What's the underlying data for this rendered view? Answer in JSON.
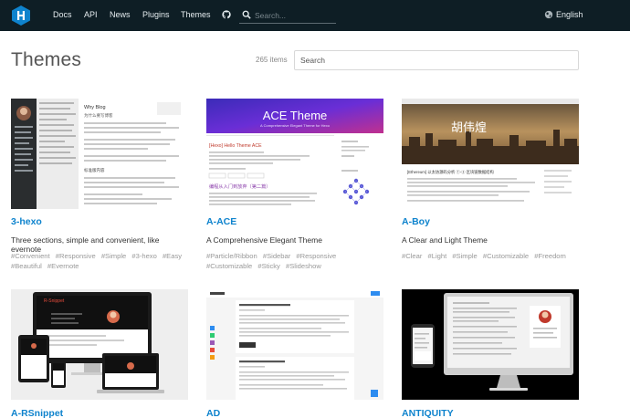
{
  "header": {
    "nav": [
      "Docs",
      "API",
      "News",
      "Plugins",
      "Themes"
    ],
    "search_placeholder": "Search...",
    "language": "English",
    "icons": [
      "hexo-logo-icon",
      "github-icon",
      "search-icon",
      "globe-icon"
    ]
  },
  "page": {
    "title": "Themes",
    "count": "265 items",
    "search_placeholder": "Search"
  },
  "themes": [
    {
      "name": "3-hexo",
      "description": "Three sections, simple and convenient, like evernote",
      "tags": [
        "#Convenient",
        "#Responsive",
        "#Simple",
        "#3-hexo",
        "#Easy",
        "#Beautiful",
        "#Evernote"
      ]
    },
    {
      "name": "A-ACE",
      "description": "A Comprehensive Elegant Theme",
      "tags": [
        "#Particle/Ribbon",
        "#Sidebar",
        "#Responsive",
        "#Customizable",
        "#Sticky",
        "#Slideshow"
      ]
    },
    {
      "name": "A-Boy",
      "description": "A Clear and Light Theme",
      "tags": [
        "#Clear",
        "#Light",
        "#Simple",
        "#Customizable",
        "#Freedom"
      ]
    },
    {
      "name": "A-RSnippet"
    },
    {
      "name": "AD"
    },
    {
      "name": "ANTIQUITY"
    }
  ],
  "previews": {
    "three_hexo": {
      "heading": "Why Blog",
      "subheading": "为什么要写博客",
      "section": "标准版内容"
    },
    "ace": {
      "title": "ACE Theme",
      "subtitle": "A Comprehensive Elegant Theme for Hexo",
      "post_title": "[Hexo] Hello Theme ACE",
      "post2_title": "编程从入门到放弃（第二篇）"
    },
    "aboy": {
      "hero_title": "胡伟煌",
      "post_title": "[Ethereum] 以太坊源码分析 ①-② 区块链数据结构"
    },
    "rsnippet": {
      "logo": "R-Snippet"
    }
  },
  "colors": {
    "header_bg": "#0e1e25",
    "accent": "#0e83cd",
    "logo": "#0e83cd"
  }
}
